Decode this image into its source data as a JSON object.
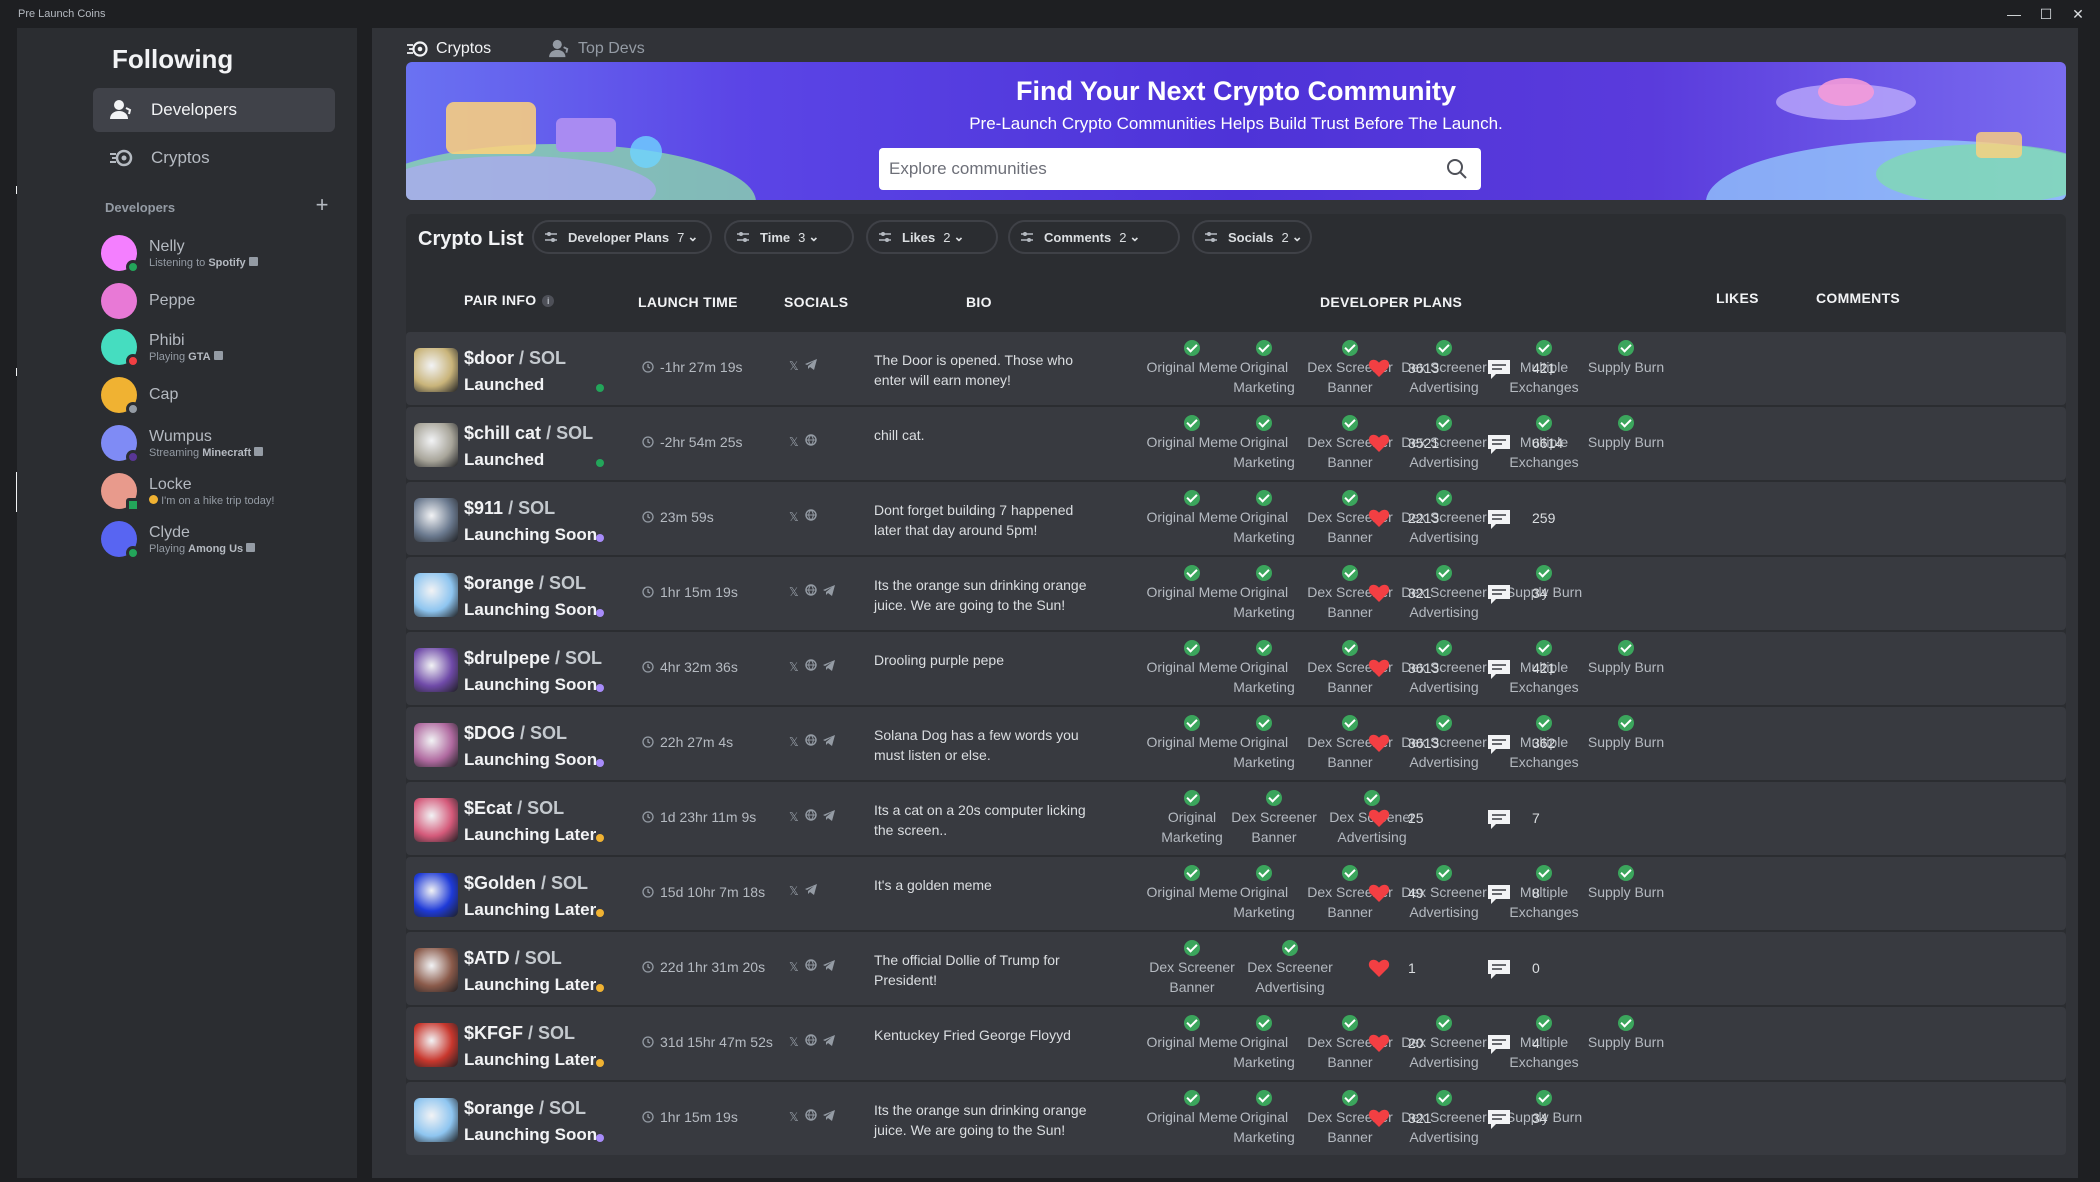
{
  "app": {
    "title": "Pre Launch Coins"
  },
  "sidebar": {
    "title": "Following",
    "nav": [
      {
        "label": "Developers",
        "icon": "developers-icon",
        "active": true
      },
      {
        "label": "Cryptos",
        "icon": "cryptos-icon",
        "active": false
      }
    ],
    "section_label": "Developers",
    "developers": [
      {
        "name": "Nelly",
        "activity_prefix": "Listening to",
        "activity_target": "Spotify",
        "status": "online",
        "avatar_color": "#f47fff"
      },
      {
        "name": "Peppe",
        "activity_prefix": "",
        "activity_target": "",
        "status": "none",
        "avatar_color": "#e879d6"
      },
      {
        "name": "Phibi",
        "activity_prefix": "Playing",
        "activity_target": "GTA",
        "status": "dnd",
        "avatar_color": "#45ddc0"
      },
      {
        "name": "Cap",
        "activity_prefix": "",
        "activity_target": "",
        "status": "idle",
        "avatar_color": "#f0b232"
      },
      {
        "name": "Wumpus",
        "activity_prefix": "Streaming",
        "activity_target": "Minecraft",
        "status": "streaming",
        "avatar_color": "#7f8bf5"
      },
      {
        "name": "Locke",
        "activity_prefix": "I'm on a hike trip today!",
        "activity_target": "",
        "status": "mobile",
        "avatar_color": "#e89a8c"
      },
      {
        "name": "Clyde",
        "activity_prefix": "Playing",
        "activity_target": "Among Us",
        "status": "online",
        "avatar_color": "#5865f2"
      }
    ]
  },
  "tabs": [
    {
      "label": "Cryptos",
      "icon": "cryptos-icon",
      "active": true
    },
    {
      "label": "Top Devs",
      "icon": "developers-icon",
      "active": false
    }
  ],
  "banner": {
    "title": "Find Your Next Crypto Community",
    "subtitle": "Pre-Launch Crypto Communities Helps Build Trust Before The Launch.",
    "search_placeholder": "Explore communities"
  },
  "list": {
    "title": "Crypto List",
    "filters": [
      {
        "label": "Developer Plans",
        "count": "7"
      },
      {
        "label": "Time",
        "count": "3"
      },
      {
        "label": "Likes",
        "count": "2"
      },
      {
        "label": "Comments",
        "count": "2"
      },
      {
        "label": "Socials",
        "count": "2"
      }
    ],
    "columns": {
      "pair": "PAIR INFO",
      "launch": "LAUNCH TIME",
      "socials": "SOCIALS",
      "bio": "BIO",
      "plans": "DEVELOPER PLANS",
      "likes": "LIKES",
      "comments": "COMMENTS"
    },
    "pair_suffix": "/ SOL",
    "rows": [
      {
        "ticker": "$door",
        "status": "Launched",
        "status_color": "#23a55a",
        "time": "-1hr 27m 19s",
        "socials": [
          "x",
          "telegram"
        ],
        "bio": "The Door is opened. Those who enter will earn money!",
        "plans": [
          "Original Meme",
          "Original Marketing",
          "Dex Screener Banner",
          "Dex Screener Advertising",
          "Multiple Exchanges",
          "Supply Burn"
        ],
        "likes": "3613",
        "comments": "421",
        "img_color": "#c9b47a"
      },
      {
        "ticker": "$chill cat",
        "status": "Launched",
        "status_color": "#23a55a",
        "time": "-2hr 54m 25s",
        "socials": [
          "x",
          "web"
        ],
        "bio": "chill cat.",
        "plans": [
          "Original Meme",
          "Original Marketing",
          "Dex Screener Banner",
          "Dex Screener Advertising",
          "Multiple Exchanges",
          "Supply Burn"
        ],
        "likes": "3521",
        "comments": "6614",
        "img_color": "#a8a59a"
      },
      {
        "ticker": "$911",
        "status": "Launching Soon",
        "status_color": "#a78bfa",
        "time": "23m 59s",
        "socials": [
          "x",
          "web"
        ],
        "bio": "Dont forget building 7 happened later that day around 5pm!",
        "plans": [
          "Original Meme",
          "Original Marketing",
          "Dex Screener Banner",
          "Dex Screener Advertising"
        ],
        "likes": "2213",
        "comments": "259",
        "img_color": "#6b7a8f"
      },
      {
        "ticker": "$orange",
        "status": "Launching Soon",
        "status_color": "#a78bfa",
        "time": "1hr 15m 19s",
        "socials": [
          "x",
          "web",
          "telegram"
        ],
        "bio": "Its the orange sun drinking orange juice. We are going to the Sun!",
        "plans": [
          "Original Meme",
          "Original Marketing",
          "Dex Screener Banner",
          "Dex Screener Advertising",
          "Supply Burn"
        ],
        "likes": "321",
        "comments": "34",
        "img_color": "#8ec5f0"
      },
      {
        "ticker": "$drulpepe",
        "status": "Launching Soon",
        "status_color": "#a78bfa",
        "time": "4hr 32m 36s",
        "socials": [
          "x",
          "web",
          "telegram"
        ],
        "bio": "Drooling purple pepe",
        "plans": [
          "Original Meme",
          "Original Marketing",
          "Dex Screener Banner",
          "Dex Screener Advertising",
          "Multiple Exchanges",
          "Supply Burn"
        ],
        "likes": "3613",
        "comments": "421",
        "img_color": "#6f4aa8"
      },
      {
        "ticker": "$DOG",
        "status": "Launching Soon",
        "status_color": "#a78bfa",
        "time": "22h 27m 4s",
        "socials": [
          "x",
          "web",
          "telegram"
        ],
        "bio": "Solana Dog has a few words you must listen or else.",
        "plans": [
          "Original Meme",
          "Original Marketing",
          "Dex Screener Banner",
          "Dex Screener Advertising",
          "Multiple Exchanges",
          "Supply Burn"
        ],
        "likes": "3613",
        "comments": "362",
        "img_color": "#b06aa0"
      },
      {
        "ticker": "$Ecat",
        "status": "Launching Later",
        "status_color": "#f0b232",
        "time": "1d 23hr 11m 9s",
        "socials": [
          "x",
          "web",
          "telegram"
        ],
        "bio": "Its a cat on a 20s computer licking the screen..",
        "plans": [
          "Original Marketing",
          "Dex Screener Banner",
          "Dex Screener Advertising"
        ],
        "likes": "25",
        "comments": "7",
        "img_color": "#d45a7a"
      },
      {
        "ticker": "$Golden",
        "status": "Launching Later",
        "status_color": "#f0b232",
        "time": "15d 10hr 7m 18s",
        "socials": [
          "x",
          "telegram"
        ],
        "bio": "It's a golden meme",
        "plans": [
          "Original Meme",
          "Original Marketing",
          "Dex Screener Banner",
          "Dex Screener Advertising",
          "Multiple Exchanges",
          "Supply Burn"
        ],
        "likes": "49",
        "comments": "8",
        "img_color": "#1e3ad8"
      },
      {
        "ticker": "$ATD",
        "status": "Launching Later",
        "status_color": "#f0b232",
        "time": "22d 1hr 31m 20s",
        "socials": [
          "x",
          "web",
          "telegram"
        ],
        "bio": "The official Dollie of Trump for President!",
        "plans": [
          "Dex Screener Banner",
          "Dex Screener Advertising"
        ],
        "likes": "1",
        "comments": "0",
        "img_color": "#8a5a4a"
      },
      {
        "ticker": "$KFGF",
        "status": "Launching Later",
        "status_color": "#f0b232",
        "time": "31d 15hr 47m 52s",
        "socials": [
          "x",
          "web",
          "telegram"
        ],
        "bio": "Kentuckey Fried George Floyyd",
        "plans": [
          "Original Meme",
          "Original Marketing",
          "Dex Screener Banner",
          "Dex Screener Advertising",
          "Multiple Exchanges",
          "Supply Burn"
        ],
        "likes": "20",
        "comments": "4",
        "img_color": "#c8372d"
      },
      {
        "ticker": "$orange",
        "status": "Launching Soon",
        "status_color": "#a78bfa",
        "time": "1hr 15m 19s",
        "socials": [
          "x",
          "web",
          "telegram"
        ],
        "bio": "Its the orange sun drinking orange juice. We are going to the Sun!",
        "plans": [
          "Original Meme",
          "Original Marketing",
          "Dex Screener Banner",
          "Dex Screener Advertising",
          "Supply Burn"
        ],
        "likes": "321",
        "comments": "34",
        "img_color": "#8ec5f0"
      }
    ]
  },
  "colors": {
    "accent": "#5865f2",
    "heart": "#f23f43",
    "check": "#3ba55c"
  }
}
